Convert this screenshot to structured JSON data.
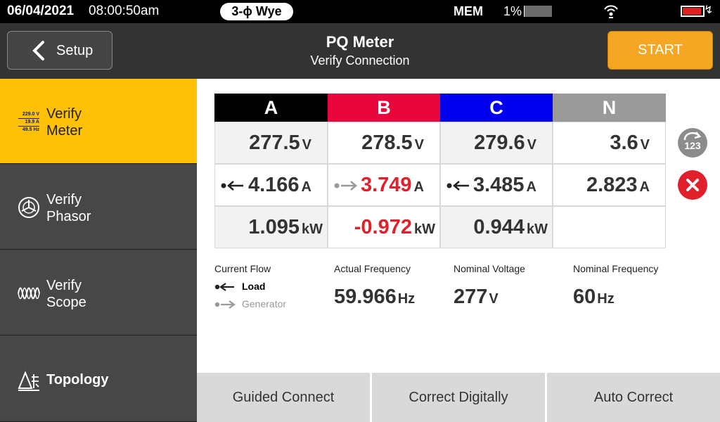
{
  "status_bar": {
    "date": "06/04/2021",
    "time": "08:00:50am",
    "wiring_config": "3-ϕ Wye",
    "mem_label": "MEM",
    "mem_percent": "1%",
    "mem_used_fraction": 0.01,
    "battery_color": "#e02020"
  },
  "header": {
    "back_label": "Setup",
    "title": "PQ Meter",
    "subtitle": "Verify Connection",
    "start_label": "START",
    "start_color": "#f5a623"
  },
  "sidebar": {
    "items": [
      {
        "label_line1": "Verify",
        "label_line2": "Meter",
        "icon": "meter-readings-icon",
        "mini_values": [
          "229.0 V",
          "19.9 A",
          "49.5 Hz"
        ],
        "active": true
      },
      {
        "label_line1": "Verify",
        "label_line2": "Phasor",
        "icon": "phasor-icon",
        "active": false
      },
      {
        "label_line1": "Verify",
        "label_line2": "Scope",
        "icon": "waveform-icon",
        "active": false
      },
      {
        "label": "Topology",
        "icon": "topology-icon",
        "active": false
      }
    ]
  },
  "table": {
    "phases": [
      {
        "label": "A",
        "color": "#000000"
      },
      {
        "label": "B",
        "color": "#e8063c"
      },
      {
        "label": "C",
        "color": "#0000ee"
      },
      {
        "label": "N",
        "color": "#9a9a9a"
      }
    ],
    "voltage": [
      {
        "value": "277.5",
        "unit": "V"
      },
      {
        "value": "278.5",
        "unit": "V"
      },
      {
        "value": "279.6",
        "unit": "V"
      },
      {
        "value": "3.6",
        "unit": "V"
      }
    ],
    "current": [
      {
        "value": "4.166",
        "unit": "A",
        "flow": "load"
      },
      {
        "value": "3.749",
        "unit": "A",
        "flow": "generator"
      },
      {
        "value": "3.485",
        "unit": "A",
        "flow": "load"
      },
      {
        "value": "2.823",
        "unit": "A",
        "flow": "none"
      }
    ],
    "power": [
      {
        "value": "1.095",
        "unit": "kW"
      },
      {
        "value": "-0.972",
        "unit": "kW"
      },
      {
        "value": "0.944",
        "unit": "kW"
      }
    ]
  },
  "side_buttons": {
    "digits_label": "123",
    "clear_icon": "close-icon"
  },
  "info": {
    "current_flow_label": "Current Flow",
    "load_label": "Load",
    "generator_label": "Generator",
    "actual_frequency_label": "Actual Frequency",
    "actual_frequency_value": "59.966",
    "actual_frequency_unit": "Hz",
    "nominal_voltage_label": "Nominal Voltage",
    "nominal_voltage_value": "277",
    "nominal_voltage_unit": "V",
    "nominal_frequency_label": "Nominal Frequency",
    "nominal_frequency_value": "60",
    "nominal_frequency_unit": "Hz"
  },
  "bottom_buttons": {
    "guided_connect": "Guided Connect",
    "correct_digitally": "Correct Digitally",
    "auto_correct": "Auto Correct"
  }
}
